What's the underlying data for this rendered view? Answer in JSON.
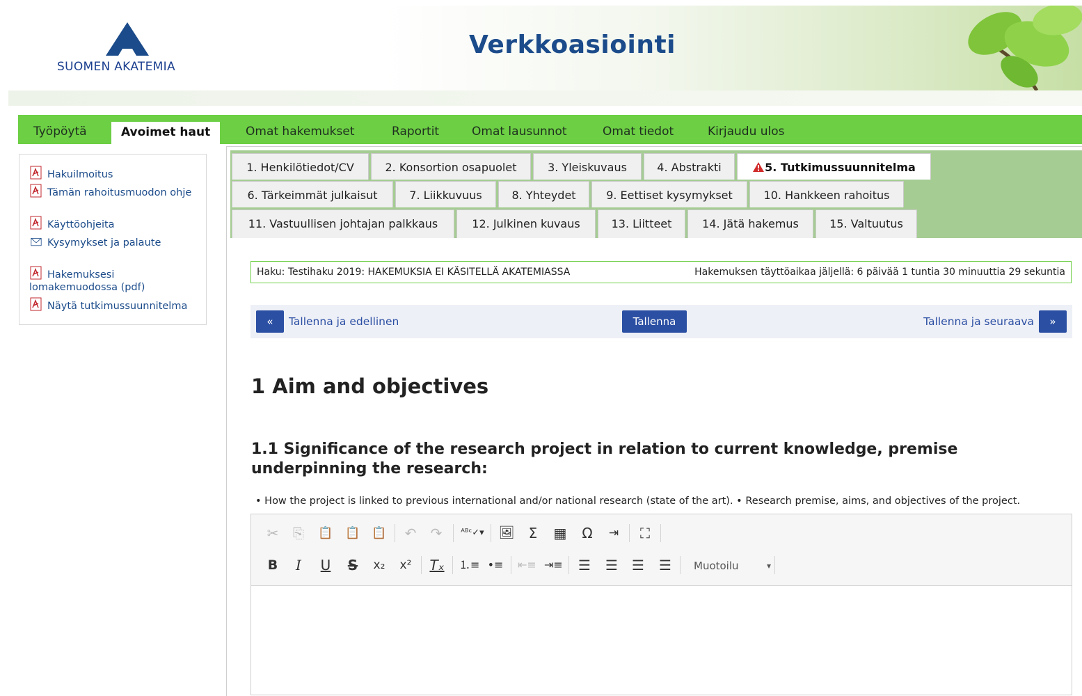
{
  "header": {
    "logo_text": "SUOMEN AKATEMIA",
    "site_title": "Verkkoasiointi"
  },
  "nav": {
    "items": [
      "Työpöytä",
      "Avoimet haut",
      "Omat hakemukset",
      "Raportit",
      "Omat lausunnot",
      "Omat tiedot",
      "Kirjaudu ulos"
    ],
    "active": "Avoimet haut"
  },
  "sidebar": {
    "links": [
      {
        "label": "Hakuilmoitus",
        "icon": "pdf-icon"
      },
      {
        "label": "Tämän rahoitusmuodon ohje",
        "icon": "pdf-icon"
      },
      {
        "label": "Käyttöohjeita",
        "icon": "pdf-icon"
      },
      {
        "label": "Kysymykset ja palaute",
        "icon": "mail-icon"
      },
      {
        "label": "Hakemuksesi lomakemuodossa (pdf)",
        "icon": "pdf-icon"
      },
      {
        "label": "Näytä tutkimussuunnitelma",
        "icon": "pdf-icon"
      }
    ]
  },
  "tabs": [
    "1. Henkilötiedot/CV",
    "2. Konsortion osapuolet",
    "3. Yleiskuvaus",
    "4. Abstrakti",
    "5. Tutkimussuunnitelma",
    "6. Tärkeimmät julkaisut",
    "7. Liikkuvuus",
    "8. Yhteydet",
    "9. Eettiset kysymykset",
    "10. Hankkeen rahoitus",
    "11. Vastuullisen johtajan palkkaus",
    "12. Julkinen kuvaus",
    "13. Liitteet",
    "14. Jätä hakemus",
    "15. Valtuutus"
  ],
  "active_tab": "5. Tutkimussuunnitelma",
  "haku": {
    "left": "Haku: Testihaku 2019: HAKEMUKSIA EI KÄSITELLÄ AKATEMIASSA",
    "right": "Hakemuksen täyttöaikaa jäljellä: 6 päivää 1 tuntia 30 minuuttia 29 sekuntia"
  },
  "savebar": {
    "prev_icon": "«",
    "prev_label": "Tallenna ja edellinen",
    "save_label": "Tallenna",
    "next_label": "Tallenna ja seuraava",
    "next_icon": "»"
  },
  "section": {
    "h1": "1 Aim and objectives",
    "h2": "1.1 Significance of the research project in relation to current knowledge, premise underpinning the research:",
    "help": "• How the project is linked to previous international and/or national research (state of the art). • Research premise, aims, and objectives of the project."
  },
  "editor": {
    "format_label": "Muotoilu",
    "row1_icons": [
      "cut-icon",
      "copy-icon",
      "paste-icon",
      "paste-text-icon",
      "paste-word-icon",
      "undo-icon",
      "redo-icon",
      "spellcheck-icon",
      "image-icon",
      "sigma-icon",
      "table-icon",
      "omega-icon",
      "indent-list-icon",
      "maximize-icon"
    ],
    "row2_icons": [
      "bold-icon",
      "italic-icon",
      "underline-icon",
      "strike-icon",
      "subscript-icon",
      "superscript-icon",
      "remove-format-icon",
      "numbered-list-icon",
      "bulleted-list-icon",
      "outdent-icon",
      "indent-icon",
      "align-left-icon",
      "align-center-icon",
      "align-right-icon",
      "justify-icon"
    ]
  },
  "colors": {
    "nav_green": "#6ccf44",
    "tab_area_green": "#a5cd93",
    "brand_blue": "#1b4b8a",
    "button_blue": "#2b4fa3"
  }
}
